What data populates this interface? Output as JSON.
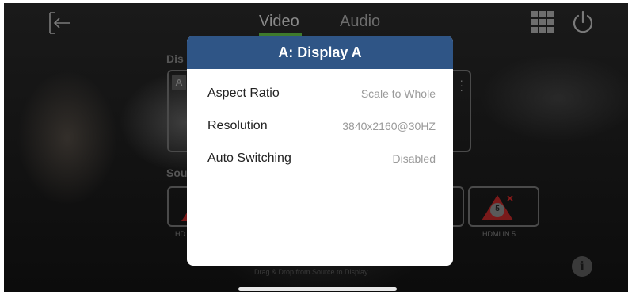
{
  "tabs": [
    {
      "label": "Video",
      "active": true
    },
    {
      "label": "Audio",
      "active": false
    }
  ],
  "sections": {
    "display_label": "Dis",
    "source_label": "Sou"
  },
  "display_card": {
    "letter": "A"
  },
  "sources": [
    {
      "label": "HD"
    },
    {
      "label": "HDMI IN 5",
      "badge": "5"
    }
  ],
  "hint": "Drag & Drop from Source to Display",
  "modal": {
    "title": "A: Display A",
    "rows": [
      {
        "label": "Aspect Ratio",
        "value": "Scale to Whole"
      },
      {
        "label": "Resolution",
        "value": "3840x2160@30HZ"
      },
      {
        "label": "Auto Switching",
        "value": "Disabled"
      }
    ]
  },
  "icons": {
    "back": "back-arrow-icon",
    "grid": "grid-icon",
    "power": "power-icon",
    "info": "info-icon"
  },
  "colors": {
    "modal_header": "#2f5586",
    "tab_active_underline": "#3e7a2c",
    "warning": "#8b1a1a"
  }
}
